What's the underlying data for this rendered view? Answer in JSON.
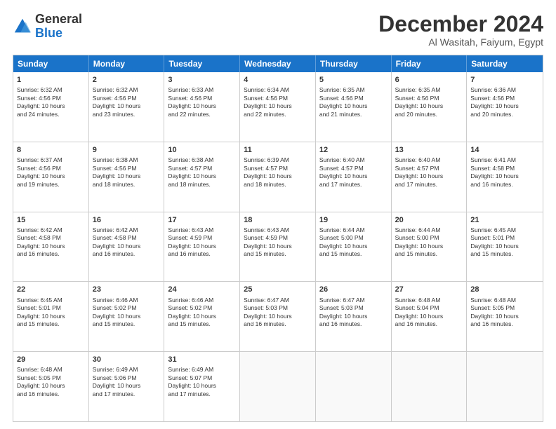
{
  "logo": {
    "line1": "General",
    "line2": "Blue"
  },
  "title": "December 2024",
  "subtitle": "Al Wasitah, Faiyum, Egypt",
  "header_days": [
    "Sunday",
    "Monday",
    "Tuesday",
    "Wednesday",
    "Thursday",
    "Friday",
    "Saturday"
  ],
  "weeks": [
    [
      {
        "day": "1",
        "info": "Sunrise: 6:32 AM\nSunset: 4:56 PM\nDaylight: 10 hours\nand 24 minutes."
      },
      {
        "day": "2",
        "info": "Sunrise: 6:32 AM\nSunset: 4:56 PM\nDaylight: 10 hours\nand 23 minutes."
      },
      {
        "day": "3",
        "info": "Sunrise: 6:33 AM\nSunset: 4:56 PM\nDaylight: 10 hours\nand 22 minutes."
      },
      {
        "day": "4",
        "info": "Sunrise: 6:34 AM\nSunset: 4:56 PM\nDaylight: 10 hours\nand 22 minutes."
      },
      {
        "day": "5",
        "info": "Sunrise: 6:35 AM\nSunset: 4:56 PM\nDaylight: 10 hours\nand 21 minutes."
      },
      {
        "day": "6",
        "info": "Sunrise: 6:35 AM\nSunset: 4:56 PM\nDaylight: 10 hours\nand 20 minutes."
      },
      {
        "day": "7",
        "info": "Sunrise: 6:36 AM\nSunset: 4:56 PM\nDaylight: 10 hours\nand 20 minutes."
      }
    ],
    [
      {
        "day": "8",
        "info": "Sunrise: 6:37 AM\nSunset: 4:56 PM\nDaylight: 10 hours\nand 19 minutes."
      },
      {
        "day": "9",
        "info": "Sunrise: 6:38 AM\nSunset: 4:56 PM\nDaylight: 10 hours\nand 18 minutes."
      },
      {
        "day": "10",
        "info": "Sunrise: 6:38 AM\nSunset: 4:57 PM\nDaylight: 10 hours\nand 18 minutes."
      },
      {
        "day": "11",
        "info": "Sunrise: 6:39 AM\nSunset: 4:57 PM\nDaylight: 10 hours\nand 18 minutes."
      },
      {
        "day": "12",
        "info": "Sunrise: 6:40 AM\nSunset: 4:57 PM\nDaylight: 10 hours\nand 17 minutes."
      },
      {
        "day": "13",
        "info": "Sunrise: 6:40 AM\nSunset: 4:57 PM\nDaylight: 10 hours\nand 17 minutes."
      },
      {
        "day": "14",
        "info": "Sunrise: 6:41 AM\nSunset: 4:58 PM\nDaylight: 10 hours\nand 16 minutes."
      }
    ],
    [
      {
        "day": "15",
        "info": "Sunrise: 6:42 AM\nSunset: 4:58 PM\nDaylight: 10 hours\nand 16 minutes."
      },
      {
        "day": "16",
        "info": "Sunrise: 6:42 AM\nSunset: 4:58 PM\nDaylight: 10 hours\nand 16 minutes."
      },
      {
        "day": "17",
        "info": "Sunrise: 6:43 AM\nSunset: 4:59 PM\nDaylight: 10 hours\nand 16 minutes."
      },
      {
        "day": "18",
        "info": "Sunrise: 6:43 AM\nSunset: 4:59 PM\nDaylight: 10 hours\nand 15 minutes."
      },
      {
        "day": "19",
        "info": "Sunrise: 6:44 AM\nSunset: 5:00 PM\nDaylight: 10 hours\nand 15 minutes."
      },
      {
        "day": "20",
        "info": "Sunrise: 6:44 AM\nSunset: 5:00 PM\nDaylight: 10 hours\nand 15 minutes."
      },
      {
        "day": "21",
        "info": "Sunrise: 6:45 AM\nSunset: 5:01 PM\nDaylight: 10 hours\nand 15 minutes."
      }
    ],
    [
      {
        "day": "22",
        "info": "Sunrise: 6:45 AM\nSunset: 5:01 PM\nDaylight: 10 hours\nand 15 minutes."
      },
      {
        "day": "23",
        "info": "Sunrise: 6:46 AM\nSunset: 5:02 PM\nDaylight: 10 hours\nand 15 minutes."
      },
      {
        "day": "24",
        "info": "Sunrise: 6:46 AM\nSunset: 5:02 PM\nDaylight: 10 hours\nand 15 minutes."
      },
      {
        "day": "25",
        "info": "Sunrise: 6:47 AM\nSunset: 5:03 PM\nDaylight: 10 hours\nand 16 minutes."
      },
      {
        "day": "26",
        "info": "Sunrise: 6:47 AM\nSunset: 5:03 PM\nDaylight: 10 hours\nand 16 minutes."
      },
      {
        "day": "27",
        "info": "Sunrise: 6:48 AM\nSunset: 5:04 PM\nDaylight: 10 hours\nand 16 minutes."
      },
      {
        "day": "28",
        "info": "Sunrise: 6:48 AM\nSunset: 5:05 PM\nDaylight: 10 hours\nand 16 minutes."
      }
    ],
    [
      {
        "day": "29",
        "info": "Sunrise: 6:48 AM\nSunset: 5:05 PM\nDaylight: 10 hours\nand 16 minutes."
      },
      {
        "day": "30",
        "info": "Sunrise: 6:49 AM\nSunset: 5:06 PM\nDaylight: 10 hours\nand 17 minutes."
      },
      {
        "day": "31",
        "info": "Sunrise: 6:49 AM\nSunset: 5:07 PM\nDaylight: 10 hours\nand 17 minutes."
      },
      {
        "day": "",
        "info": ""
      },
      {
        "day": "",
        "info": ""
      },
      {
        "day": "",
        "info": ""
      },
      {
        "day": "",
        "info": ""
      }
    ]
  ]
}
